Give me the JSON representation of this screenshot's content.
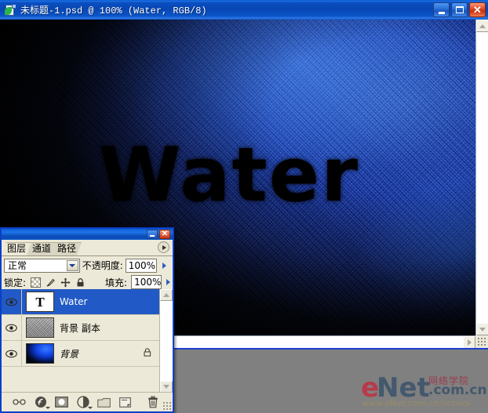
{
  "document_window": {
    "title": "未标题-1.psd @ 100% (Water, RGB/8)",
    "icon": "photoshop-document-icon",
    "canvas_text": "Water",
    "buttons": {
      "minimize": "_",
      "maximize": "□",
      "close": "✕"
    }
  },
  "layers_palette": {
    "window_buttons": {
      "minimize": "_",
      "close": "✕"
    },
    "tabs": [
      {
        "label": "图层",
        "active": true
      },
      {
        "label": "通道",
        "active": false
      },
      {
        "label": "路径",
        "active": false
      }
    ],
    "menu_icon": "palette-menu-arrow-icon",
    "blend_mode": {
      "value": "正常",
      "dropdown_icon": "chevron-down-icon"
    },
    "opacity": {
      "label": "不透明度:",
      "value": "100%",
      "stepper_icon": "right-triangle-icon"
    },
    "lock": {
      "label": "锁定:",
      "icons": [
        "lock-transparent-pixels-icon",
        "lock-image-pixels-icon",
        "lock-position-icon",
        "lock-all-icon"
      ]
    },
    "fill": {
      "label": "填充:",
      "value": "100%",
      "stepper_icon": "right-triangle-icon"
    },
    "layers": [
      {
        "name": "Water",
        "thumb": "text-layer-thumbnail",
        "thumb_glyph": "T",
        "visible": true,
        "selected": true,
        "locked": false,
        "italic": false
      },
      {
        "name": "背景 副本",
        "thumb": "gray-noise-thumbnail",
        "thumb_glyph": "",
        "visible": true,
        "selected": false,
        "locked": false,
        "italic": false
      },
      {
        "name": "背景",
        "thumb": "blue-gradient-thumbnail",
        "thumb_glyph": "",
        "visible": true,
        "selected": false,
        "locked": true,
        "italic": true
      }
    ],
    "bottom_toolbar": [
      "link-layers-icon",
      "layer-style-fx-icon",
      "layer-mask-icon",
      "adjustment-layer-icon",
      "new-group-icon",
      "new-layer-icon",
      "delete-layer-icon"
    ],
    "scrollbar": {
      "up_icon": "scroll-up-icon",
      "down_icon": "scroll-down-icon"
    }
  },
  "doc_scrollbars": {
    "vertical": {
      "up_icon": "scroll-up-icon",
      "down_icon": "scroll-down-icon"
    },
    "horizontal": {
      "left_icon": "scroll-left-icon",
      "right_icon": "scroll-right-icon",
      "play_icon": "play-triangle-icon"
    },
    "resize_grip": "resize-grip-icon"
  },
  "watermark": {
    "e": "e",
    "net": "Net",
    "cn_top": "网络学院",
    "com": ".com.cn",
    "url": "www.eNet.com.cn/school"
  },
  "colors": {
    "titlebar_blue": "#0a4fc0",
    "palette_bg": "#ece9d8",
    "selection_blue": "#2159c6",
    "canvas_blue": "#1240dc",
    "desktop_gray": "#808080",
    "enet_red": "#b83a4b",
    "enet_slate": "#44586e"
  }
}
